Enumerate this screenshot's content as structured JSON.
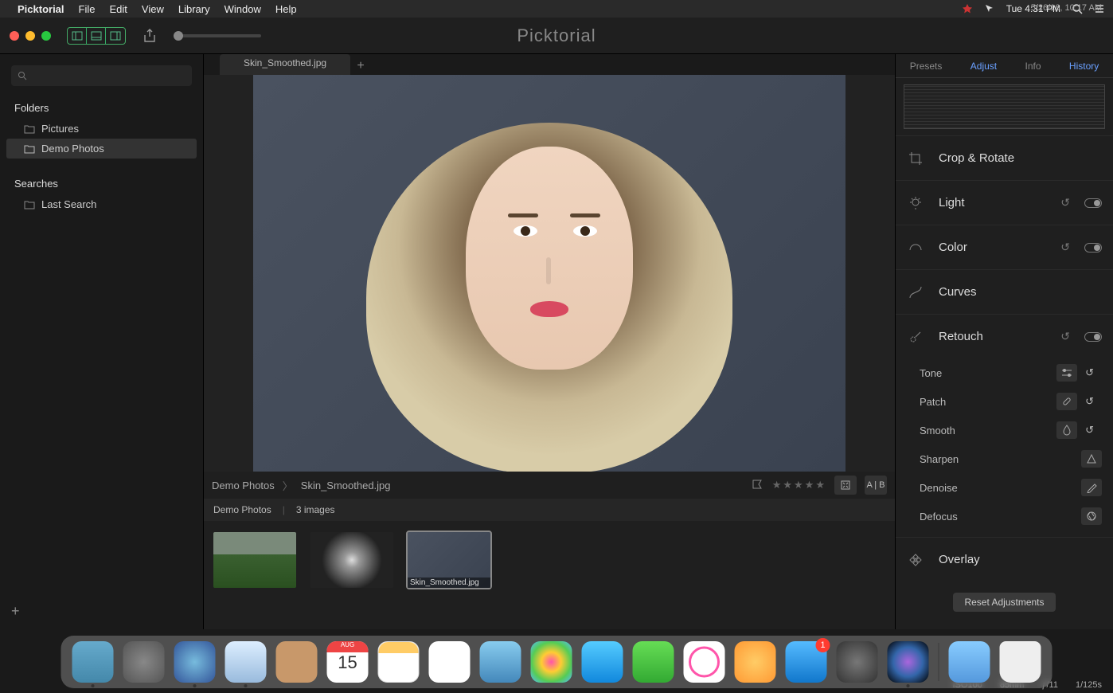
{
  "menubar": {
    "app": "Picktorial",
    "items": [
      "File",
      "Edit",
      "View",
      "Library",
      "Window",
      "Help"
    ],
    "clock": "Tue 4:31 PM"
  },
  "toolbar": {
    "title": "Picktorial",
    "datetime": "5/26/16, 10:17 AM",
    "iso": "ISO100",
    "focal": "85mm",
    "aperture": "ƒ/11",
    "shutter": "1/125s"
  },
  "sidebar": {
    "folders_hdr": "Folders",
    "folders": [
      "Pictures",
      "Demo Photos"
    ],
    "searches_hdr": "Searches",
    "searches": [
      "Last Search"
    ]
  },
  "tabs": {
    "open": "Skin_Smoothed.jpg"
  },
  "pathbar": {
    "folder": "Demo Photos",
    "file": "Skin_Smoothed.jpg",
    "compare": "A | B"
  },
  "strip": {
    "folder": "Demo Photos",
    "count": "3 images",
    "sel_caption": "Skin_Smoothed.jpg"
  },
  "rpanel": {
    "tabs": [
      "Presets",
      "Adjust",
      "Info",
      "History"
    ],
    "tools": {
      "crop": "Crop & Rotate",
      "light": "Light",
      "color": "Color",
      "curves": "Curves",
      "retouch": "Retouch",
      "overlay": "Overlay"
    },
    "retouch_sub": [
      "Tone",
      "Patch",
      "Smooth",
      "Sharpen",
      "Denoise",
      "Defocus"
    ],
    "reset": "Reset Adjustments"
  },
  "dock": {
    "badge": "1"
  }
}
